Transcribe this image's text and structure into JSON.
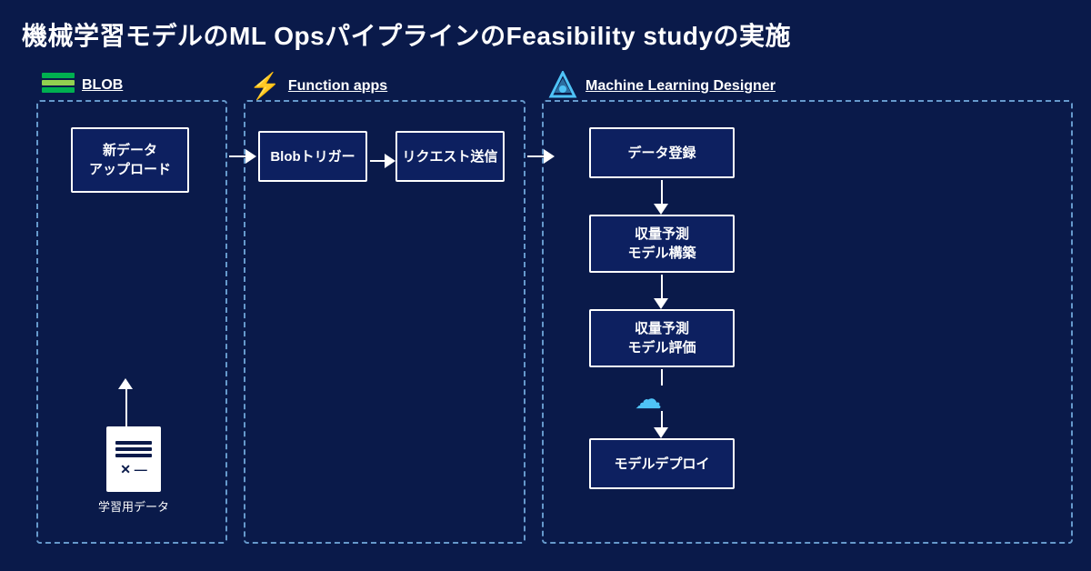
{
  "page": {
    "title": "機械学習モデルのML OpsパイプラインのFeasibility studyの実施",
    "bg_color": "#0a1a4a"
  },
  "sections": {
    "blob": {
      "label": "BLOB",
      "box1": "新データ\nアップロード",
      "doc_label": "学習用データ"
    },
    "func": {
      "label": "Function apps",
      "box1": "Blobトリガー",
      "box2": "リクエスト送信"
    },
    "ml": {
      "label": "Machine Learning Designer",
      "box1": "データ登録",
      "box2": "収量予測\nモデル構築",
      "box3": "収量予測\nモデル評価",
      "box4": "モデルデプロイ"
    }
  }
}
